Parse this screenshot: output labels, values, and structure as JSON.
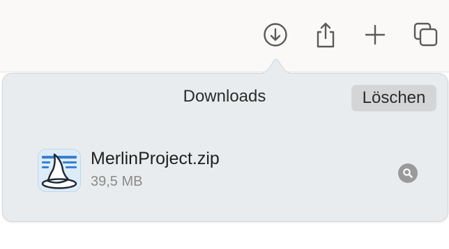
{
  "toolbar": {
    "buttons": [
      {
        "icon": "download-icon"
      },
      {
        "icon": "share-icon"
      },
      {
        "icon": "plus-icon"
      },
      {
        "icon": "tabs-overview-icon"
      }
    ]
  },
  "downloads": {
    "title": "Downloads",
    "clear_label": "Löschen",
    "items": [
      {
        "name": "MerlinProject.zip",
        "size": "39,5 MB",
        "icon": "merlin-project-app-icon",
        "action_icon": "magnifier-icon"
      }
    ]
  },
  "colors": {
    "toolbar_bg": "#fbf8f8",
    "popover_bg": "#e9ecee",
    "clear_button_bg": "#d3d5d7",
    "icon_gray": "#595959"
  }
}
